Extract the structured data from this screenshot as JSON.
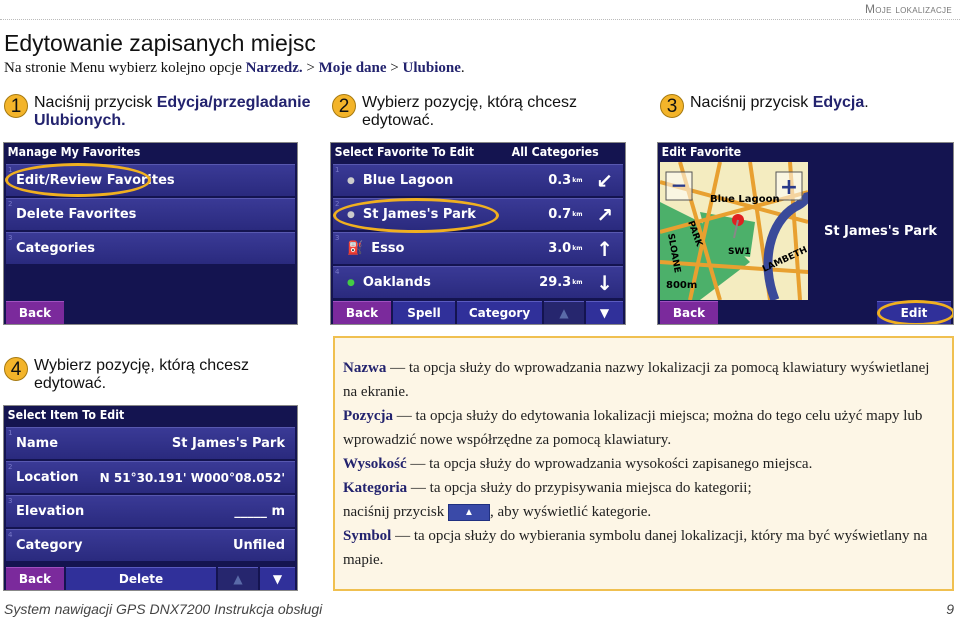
{
  "header": {
    "section": "Moje lokalizacje",
    "title": "Edytowanie zapisanych miejsc",
    "intro_pre": "Na stronie Menu wybierz kolejno opcje ",
    "path1": "Narzedz.",
    "sep1": " > ",
    "path2": "Moje dane",
    "sep2": " > ",
    "path3": "Ulubione",
    "intro_post": "."
  },
  "steps": [
    {
      "num": "1",
      "pre": "Naciśnij przycisk ",
      "bold": "Edycja/przegladanie Ulubionych.",
      "post": ""
    },
    {
      "num": "2",
      "pre": "Wybierz pozycję, którą chcesz edytować.",
      "bold": "",
      "post": ""
    },
    {
      "num": "3",
      "pre": "Naciśnij przycisk ",
      "bold": "Edycja",
      "post": "."
    },
    {
      "num": "4",
      "pre": "Wybierz pozycję, którą chcesz edytować.",
      "bold": "",
      "post": ""
    }
  ],
  "screen1": {
    "title": "Manage My Favorites",
    "items": [
      {
        "idx": "1",
        "label": "Edit/Review Favorites"
      },
      {
        "idx": "2",
        "label": "Delete Favorites"
      },
      {
        "idx": "3",
        "label": "Categories"
      }
    ],
    "back": "Back"
  },
  "screen2": {
    "title": "Select Favorite To Edit",
    "filter": "All Categories",
    "items": [
      {
        "idx": "1",
        "icon": "flag-icon",
        "name": "Blue Lagoon",
        "dist": "0.3",
        "unit": "km",
        "arrow": "arrow-southwest-icon"
      },
      {
        "idx": "2",
        "icon": "flag-icon",
        "name": "St James's Park",
        "dist": "0.7",
        "unit": "km",
        "arrow": "arrow-northeast-icon"
      },
      {
        "idx": "3",
        "icon": "fuel-icon",
        "name": "Esso",
        "dist": "3.0",
        "unit": "km",
        "arrow": "arrow-north-icon"
      },
      {
        "idx": "4",
        "icon": "flag-icon",
        "name": "Oaklands",
        "dist": "29.3",
        "unit": "km",
        "arrow": "arrow-south-icon"
      }
    ],
    "back": "Back",
    "spell": "Spell",
    "category": "Category"
  },
  "screen3": {
    "title": "Edit Favorite",
    "place": "St James's Park",
    "map_labels": {
      "poi": "Blue Lagoon",
      "park": "PARK",
      "sloane": "SLOANE",
      "sw1": "SW1",
      "lambeth": "LAMBETH",
      "scale": "800m"
    },
    "back": "Back",
    "edit": "Edit"
  },
  "screen4": {
    "title": "Select Item To Edit",
    "items": [
      {
        "idx": "1",
        "label": "Name",
        "value": "St James's Park"
      },
      {
        "idx": "2",
        "label": "Location",
        "value": "N 51°30.191' W000°08.052'"
      },
      {
        "idx": "3",
        "label": "Elevation",
        "value": "_____ m"
      },
      {
        "idx": "4",
        "label": "Category",
        "value": "Unfiled"
      }
    ],
    "back": "Back",
    "delete": "Delete"
  },
  "info": [
    {
      "term": "Nazwa",
      "text": " — ta opcja służy do wprowadzania nazwy lokalizacji za pomocą klawiatury wyświetlanej na ekranie."
    },
    {
      "term": "Pozycja",
      "text": " — ta opcja służy do edytowania lokalizacji miejsca; można do tego celu użyć mapy lub wprowadzić nowe współrzędne za pomocą klawiatury."
    },
    {
      "term": "Wysokość",
      "text": " — ta opcja służy do wprowadzania wysokości zapisanego miejsca."
    },
    {
      "term": "Kategoria",
      "text": " — ta opcja służy do przypisywania miejsca do kategorii;",
      "line2_pre": "naciśnij przycisk ",
      "line2_post": ", aby wyświetlić kategorie."
    },
    {
      "term": "Symbol",
      "text": " — ta opcja służy do wybierania symbolu danej lokalizacji, który ma być wyświetlany na mapie."
    }
  ],
  "footer": {
    "text": "System nawigacji GPS DNX7200 Instrukcja obsługi",
    "page": "9"
  },
  "colors": {
    "screen_bg": "#141450",
    "row": "#2e2e88",
    "back_button": "#7b2a9c",
    "highlight": "#f0b020",
    "term": "#23236e",
    "note_bg": "#fdf6e6"
  }
}
